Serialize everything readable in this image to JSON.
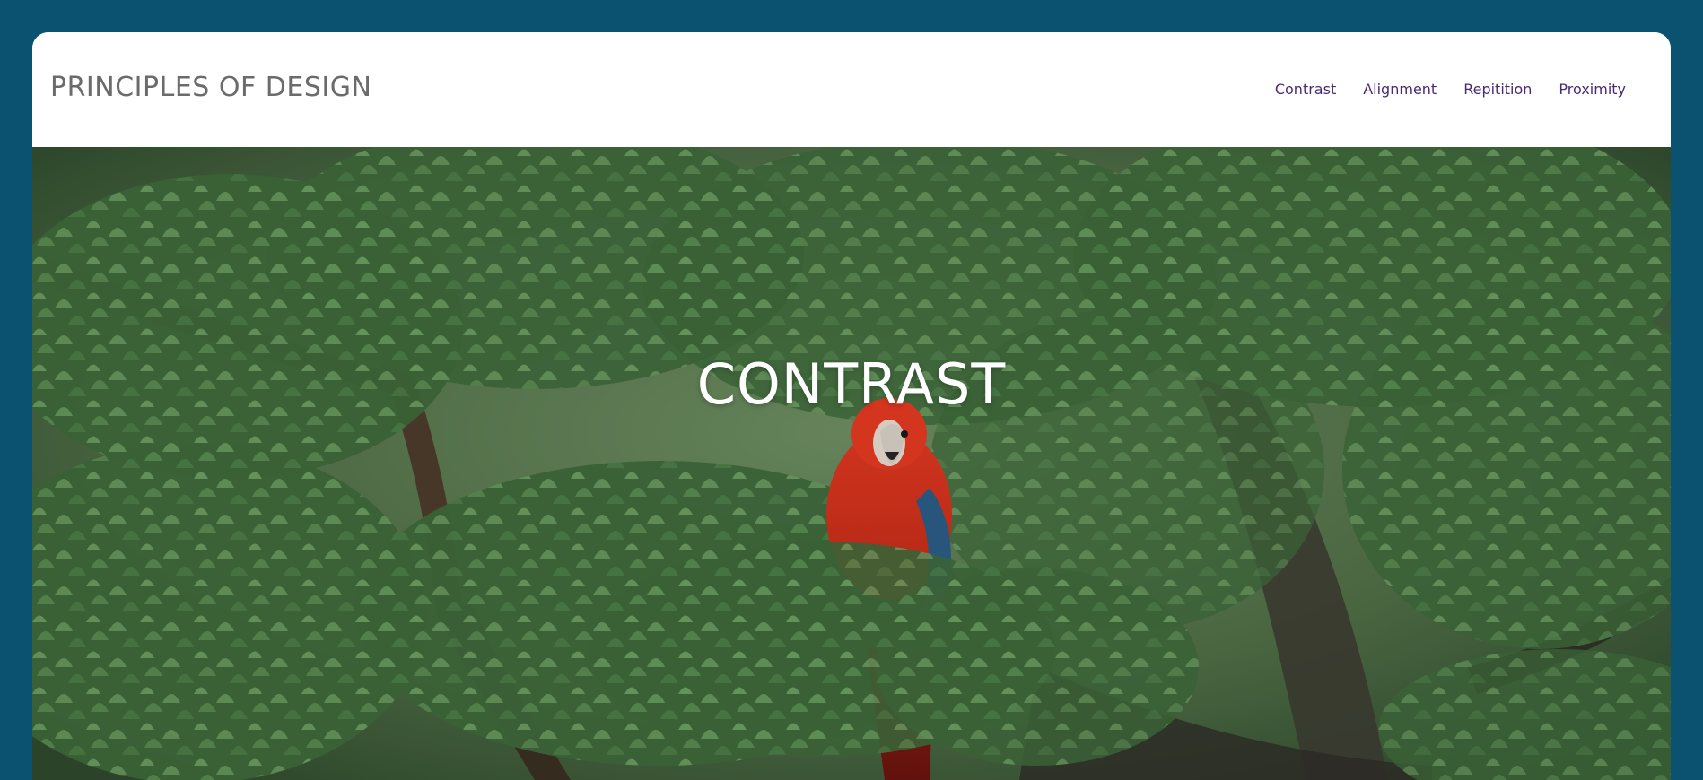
{
  "header": {
    "site_title": "PRINCIPLES OF DESIGN",
    "nav": [
      {
        "label": "Contrast"
      },
      {
        "label": "Alignment"
      },
      {
        "label": "Repitition"
      },
      {
        "label": "Proximity"
      }
    ]
  },
  "hero": {
    "title": "CONTRAST",
    "image_subject_icon": "macaw-in-tree-photo"
  },
  "colors": {
    "page_background": "#0b5271",
    "nav_link": "#4a2a72",
    "site_title": "#6b6b6b",
    "hero_title": "#ffffff"
  }
}
